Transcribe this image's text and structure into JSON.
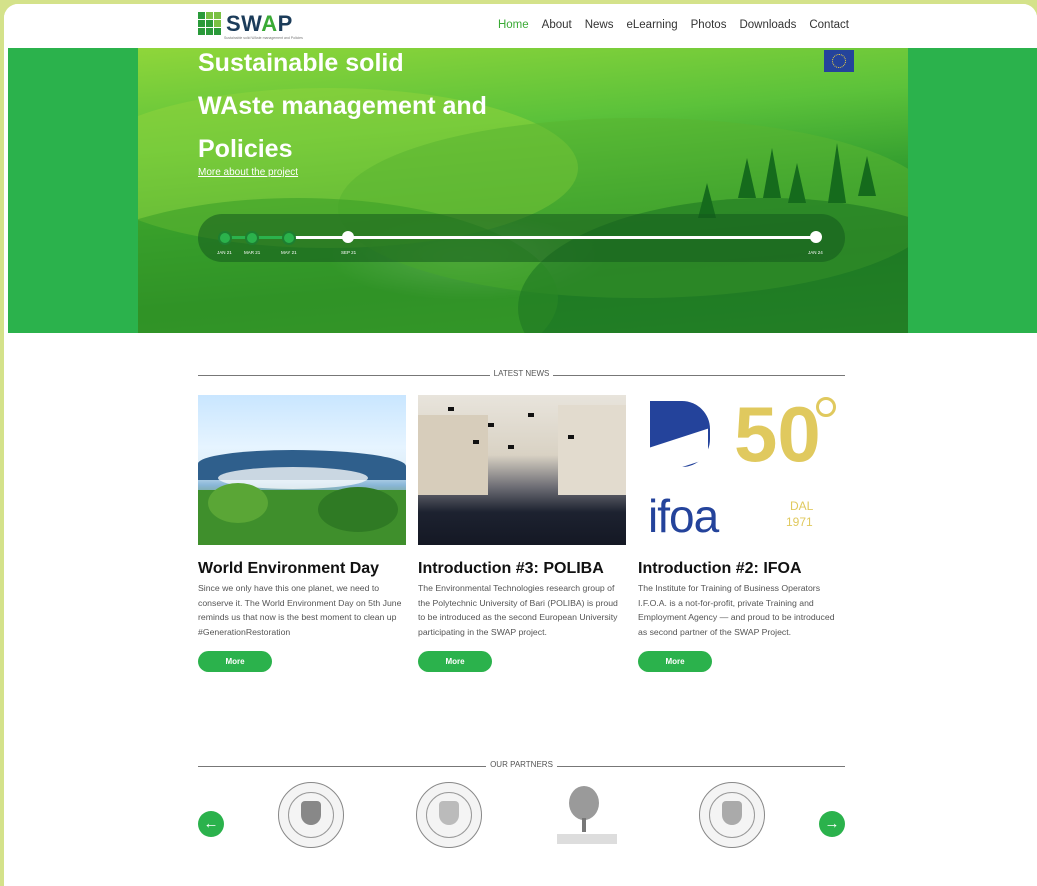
{
  "header": {
    "logo_text_prefix": "SW",
    "logo_text_accent": "A",
    "logo_text_suffix": "P",
    "logo_tagline": "Sustainable solid WAste management and Policies",
    "nav": [
      "Home",
      "About",
      "News",
      "eLearning",
      "Photos",
      "Downloads",
      "Contact"
    ],
    "active_nav": "Home"
  },
  "hero": {
    "title_line1": "Sustainable solid",
    "title_line2": "WAste management and",
    "title_line3": "Policies",
    "link": "More about the project",
    "timeline": [
      "JAN 21",
      "MAR 21",
      "MAY 21",
      "SEP 21",
      "JAN 24"
    ]
  },
  "news": {
    "section_title": "LATEST NEWS",
    "cards": [
      {
        "title": "World Environment Day",
        "text": "Since we only have this one planet, we need to conserve it. The World Environment Day on 5th June reminds us that now is the best moment to clean up #GenerationRestoration",
        "button": "More"
      },
      {
        "title": "Introduction #3: POLIBA",
        "text": "The Environmental Technologies research group of the Polytechnic University of Bari (POLIBA) is proud to be introduced as the second European University participating in the SWAP project.",
        "button": "More"
      },
      {
        "title": "Introduction #2: IFOA",
        "text": "The Institute for Training of Business Operators I.F.O.A. is a not-for-profit, private Training and Employment Agency — and proud to be introduced as second partner of the SWAP Project.",
        "button": "More",
        "logo_number": "50",
        "logo_name": "ifoa",
        "logo_dal": "DAL",
        "logo_year": "1971"
      }
    ]
  },
  "partners": {
    "section_title": "OUR PARTNERS",
    "prev": "←",
    "next": "→"
  },
  "colors": {
    "brand_green": "#2bb24c",
    "nav_active": "#3aaa35",
    "outer_bg": "#d4e28a",
    "ifoa_blue": "#24439b",
    "ifoa_gold": "#e0c95e"
  }
}
